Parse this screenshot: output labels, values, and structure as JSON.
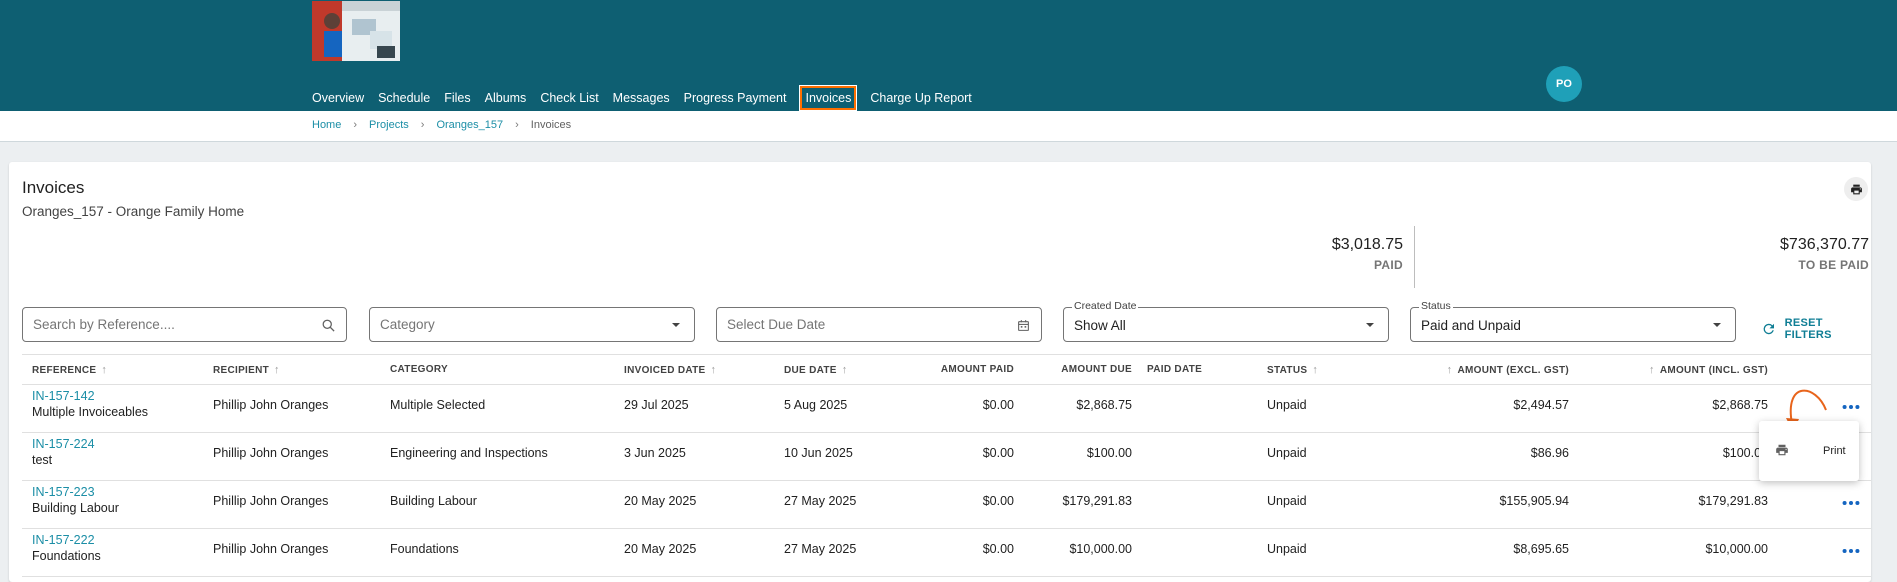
{
  "nav": {
    "items": [
      "Overview",
      "Schedule",
      "Files",
      "Albums",
      "Check List",
      "Messages",
      "Progress Payment",
      "Invoices",
      "Charge Up Report"
    ],
    "active": "Invoices"
  },
  "user": {
    "initials": "PO"
  },
  "breadcrumb": {
    "home": "Home",
    "projects": "Projects",
    "project": "Oranges_157",
    "current": "Invoices"
  },
  "page": {
    "title": "Invoices",
    "subtitle": "Oranges_157 - Orange Family Home"
  },
  "summary": {
    "paid_amount": "$3,018.75",
    "paid_label": "PAID",
    "tobepaid_amount": "$736,370.77",
    "tobepaid_label": "TO BE PAID"
  },
  "filters": {
    "search_placeholder": "Search by Reference....",
    "category_placeholder": "Category",
    "due_date_placeholder": "Select Due Date",
    "created_label": "Created Date",
    "created_value": "Show All",
    "status_label": "Status",
    "status_value": "Paid and Unpaid",
    "reset_label": "RESET FILTERS"
  },
  "table": {
    "headers": {
      "reference": "REFERENCE",
      "recipient": "RECIPIENT",
      "category": "CATEGORY",
      "invoiced_date": "INVOICED DATE",
      "due_date": "DUE DATE",
      "amount_paid": "AMOUNT PAID",
      "amount_due": "AMOUNT DUE",
      "paid_date": "PAID DATE",
      "status": "STATUS",
      "amount_excl": "AMOUNT (EXCL. GST)",
      "amount_incl": "AMOUNT (INCL. GST)"
    },
    "rows": [
      {
        "ref": "IN-157-142",
        "desc": "Multiple Invoiceables",
        "recipient": "Phillip John Oranges",
        "category": "Multiple Selected",
        "invoiced": "29 Jul 2025",
        "due": "5 Aug 2025",
        "paid": "$0.00",
        "amount_due": "$2,868.75",
        "paid_date": "",
        "status": "Unpaid",
        "excl": "$2,494.57",
        "incl": "$2,868.75"
      },
      {
        "ref": "IN-157-224",
        "desc": "test",
        "recipient": "Phillip John Oranges",
        "category": "Engineering and Inspections",
        "invoiced": "3 Jun 2025",
        "due": "10 Jun 2025",
        "paid": "$0.00",
        "amount_due": "$100.00",
        "paid_date": "",
        "status": "Unpaid",
        "excl": "$86.96",
        "incl": "$100.00"
      },
      {
        "ref": "IN-157-223",
        "desc": "Building Labour",
        "recipient": "Phillip John Oranges",
        "category": "Building Labour",
        "invoiced": "20 May 2025",
        "due": "27 May 2025",
        "paid": "$0.00",
        "amount_due": "$179,291.83",
        "paid_date": "",
        "status": "Unpaid",
        "excl": "$155,905.94",
        "incl": "$179,291.83"
      },
      {
        "ref": "IN-157-222",
        "desc": "Foundations",
        "recipient": "Phillip John Oranges",
        "category": "Foundations",
        "invoiced": "20 May 2025",
        "due": "27 May 2025",
        "paid": "$0.00",
        "amount_due": "$10,000.00",
        "paid_date": "",
        "status": "Unpaid",
        "excl": "$8,695.65",
        "incl": "$10,000.00"
      }
    ]
  },
  "context_menu": {
    "print_label": "Print"
  },
  "colors": {
    "header_bg": "#0e5f72",
    "link": "#1b8ea6",
    "accent": "#ff6f00"
  },
  "icons": [
    "search-icon",
    "chevron-down-icon",
    "calendar-icon",
    "refresh-icon",
    "print-icon",
    "more-icon",
    "arrow-up-icon"
  ]
}
